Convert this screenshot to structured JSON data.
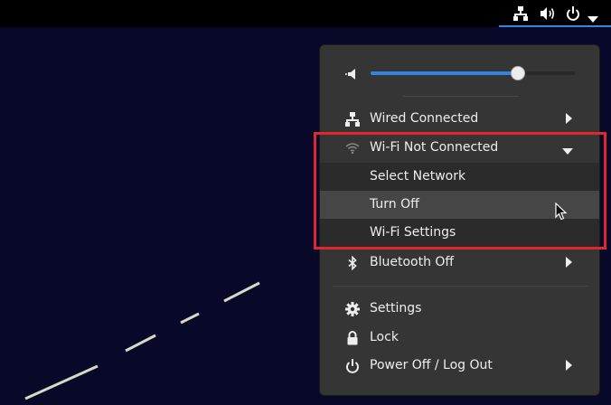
{
  "topbar": {
    "tray_icons": [
      "network-wired-icon",
      "volume-icon",
      "power-icon",
      "chevron-down-icon"
    ]
  },
  "system_menu": {
    "volume": {
      "icon": "speaker-muted-icon",
      "level": 0.72
    },
    "wired": {
      "label": "Wired Connected",
      "icon": "network-wired-icon"
    },
    "wifi": {
      "label": "Wi-Fi Not Connected",
      "icon": "wifi-icon",
      "expanded": true,
      "items": [
        {
          "label": "Select Network"
        },
        {
          "label": "Turn Off"
        },
        {
          "label": "Wi-Fi Settings"
        }
      ]
    },
    "bluetooth": {
      "label": "Bluetooth Off",
      "icon": "bluetooth-icon"
    },
    "settings": {
      "label": "Settings",
      "icon": "gear-icon"
    },
    "lock": {
      "label": "Lock",
      "icon": "lock-icon"
    },
    "power": {
      "label": "Power Off / Log Out",
      "icon": "power-icon"
    }
  },
  "colors": {
    "menu_bg": "#353535",
    "accent": "#3584e4",
    "highlight_border": "#e0262e",
    "desktop_bg": "#080828"
  }
}
